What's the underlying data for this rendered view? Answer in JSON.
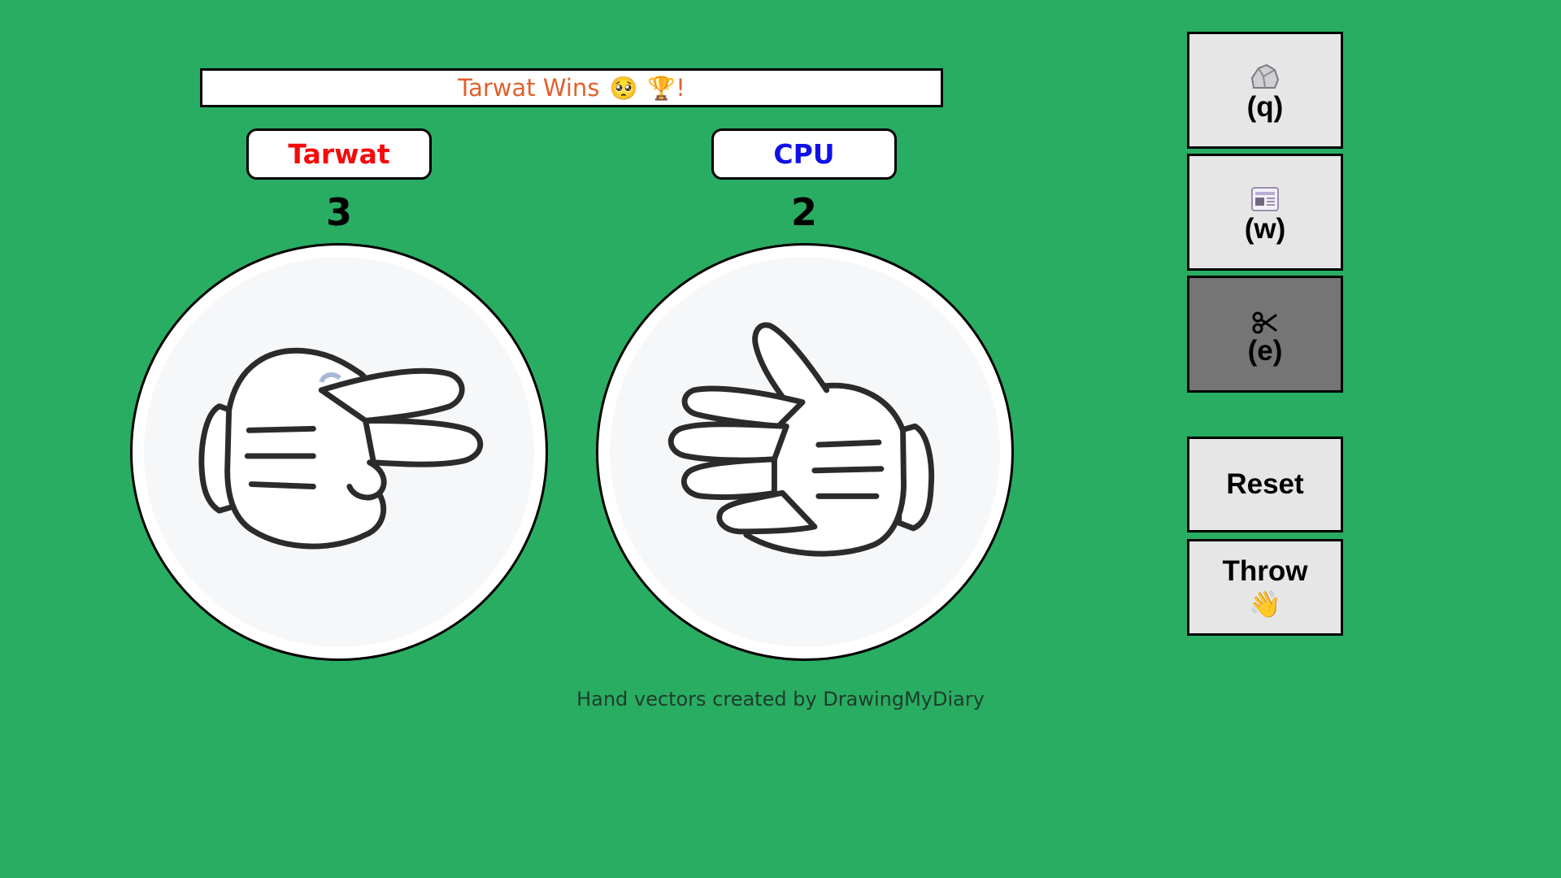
{
  "banner": {
    "text": "Tarwat Wins",
    "emoji_face": "🥺",
    "emoji_trophy": "🏆",
    "suffix": "!"
  },
  "player": {
    "name": "Tarwat",
    "score": "3",
    "hand": "scissors",
    "color": "#f50b0b"
  },
  "cpu": {
    "name": "CPU",
    "score": "2",
    "hand": "paper",
    "color": "#1010e8"
  },
  "credit": "Hand vectors created by DrawingMyDiary",
  "controls": {
    "rock": {
      "key": "(q)",
      "icon": "rock-icon"
    },
    "paper": {
      "key": "(w)",
      "icon": "newspaper-icon"
    },
    "scissors": {
      "key": "(e)",
      "icon": "scissors-icon",
      "selected": true
    },
    "reset_label": "Reset",
    "throw_label": "Throw",
    "throw_emoji": "👋"
  },
  "colors": {
    "background": "#29ad62",
    "banner_text": "#e0612e",
    "button_bg": "#e6e6e6",
    "button_selected_bg": "#757575"
  }
}
